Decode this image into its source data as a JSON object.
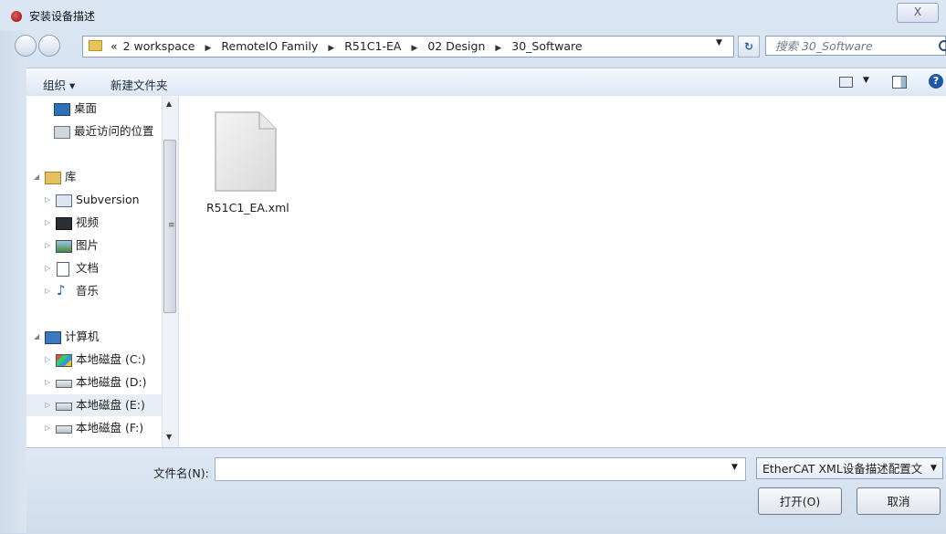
{
  "window": {
    "title": "安装设备描述",
    "close_label": "X"
  },
  "address": {
    "overflow": "«",
    "segments": [
      "2 workspace",
      "RemoteIO Family",
      "R51C1-EA",
      "02 Design",
      "30_Software"
    ],
    "search_placeholder": "搜索 30_Software"
  },
  "toolbar": {
    "organize_label": "组织 ▾",
    "new_folder_label": "新建文件夹"
  },
  "nav": {
    "items": [
      {
        "label": "桌面",
        "icon": "desktop-icon"
      },
      {
        "label": "最近访问的位置",
        "icon": "recent-places-icon"
      },
      {
        "label": "库",
        "icon": "library-icon"
      },
      {
        "label": "Subversion",
        "icon": "library-folder-icon"
      },
      {
        "label": "视频",
        "icon": "video-icon"
      },
      {
        "label": "图片",
        "icon": "picture-icon"
      },
      {
        "label": "文档",
        "icon": "document-icon"
      },
      {
        "label": "音乐",
        "icon": "music-icon"
      },
      {
        "label": "计算机",
        "icon": "computer-icon"
      },
      {
        "label": "本地磁盘 (C:)",
        "icon": "system-drive-icon"
      },
      {
        "label": "本地磁盘 (D:)",
        "icon": "drive-icon"
      },
      {
        "label": "本地磁盘 (E:)",
        "icon": "drive-icon"
      },
      {
        "label": "本地磁盘 (F:)",
        "icon": "drive-icon"
      }
    ]
  },
  "files": [
    {
      "name": "R51C1_EA.xml",
      "icon": "file-icon"
    }
  ],
  "bottom": {
    "filename_label": "文件名(N):",
    "filename_value": "",
    "filter_value": "EtherCAT XML设备描述配置文",
    "open_label": "打开(O)",
    "cancel_label": "取消"
  }
}
